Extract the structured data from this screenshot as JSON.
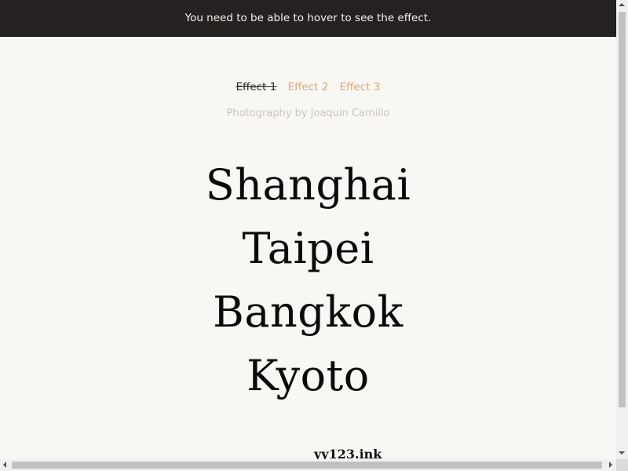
{
  "notice": {
    "text": "You need to be able to hover to see the effect."
  },
  "effects": {
    "items": [
      {
        "label": "Effect 1",
        "active": true
      },
      {
        "label": "Effect 2",
        "active": false
      },
      {
        "label": "Effect 3",
        "active": false
      }
    ]
  },
  "credit": {
    "text": "Photography by Joaquin Camillo"
  },
  "cities": [
    {
      "name": "Shanghai"
    },
    {
      "name": "Taipei"
    },
    {
      "name": "Bangkok"
    },
    {
      "name": "Kyoto"
    }
  ],
  "watermark": {
    "text": "yy123.ink"
  },
  "colors": {
    "background": "#f9f7f4",
    "notice_bar": "#252121",
    "accent": "#e3a66a",
    "credit": "#cbc5bf",
    "city_text": "#0b0909"
  }
}
